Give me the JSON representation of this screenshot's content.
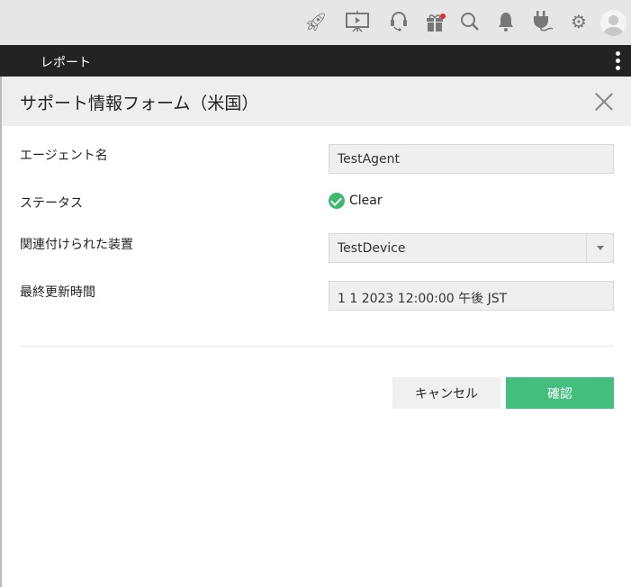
{
  "topbar": {
    "icons": [
      "rocket-icon",
      "presentation-icon",
      "headset-icon",
      "gift-icon",
      "search-icon",
      "bell-icon",
      "plug-icon",
      "gear-icon",
      "avatar"
    ]
  },
  "nav": {
    "title": "レポート"
  },
  "dialog": {
    "title": "サポート情報フォーム（米国）",
    "fields": {
      "agent_label": "エージェント名",
      "agent_value": "TestAgent",
      "status_label": "ステータス",
      "status_value": "Clear",
      "device_label": "関連付けられた装置",
      "device_value": "TestDevice",
      "updated_label": "最終更新時間",
      "updated_value": "1 1 2023 12:00:00 午後 JST"
    },
    "cancel_label": "キャンセル",
    "confirm_label": "確認"
  },
  "colors": {
    "accent": "#43be7d",
    "navbar": "#232323",
    "notification": "#e8262c"
  }
}
